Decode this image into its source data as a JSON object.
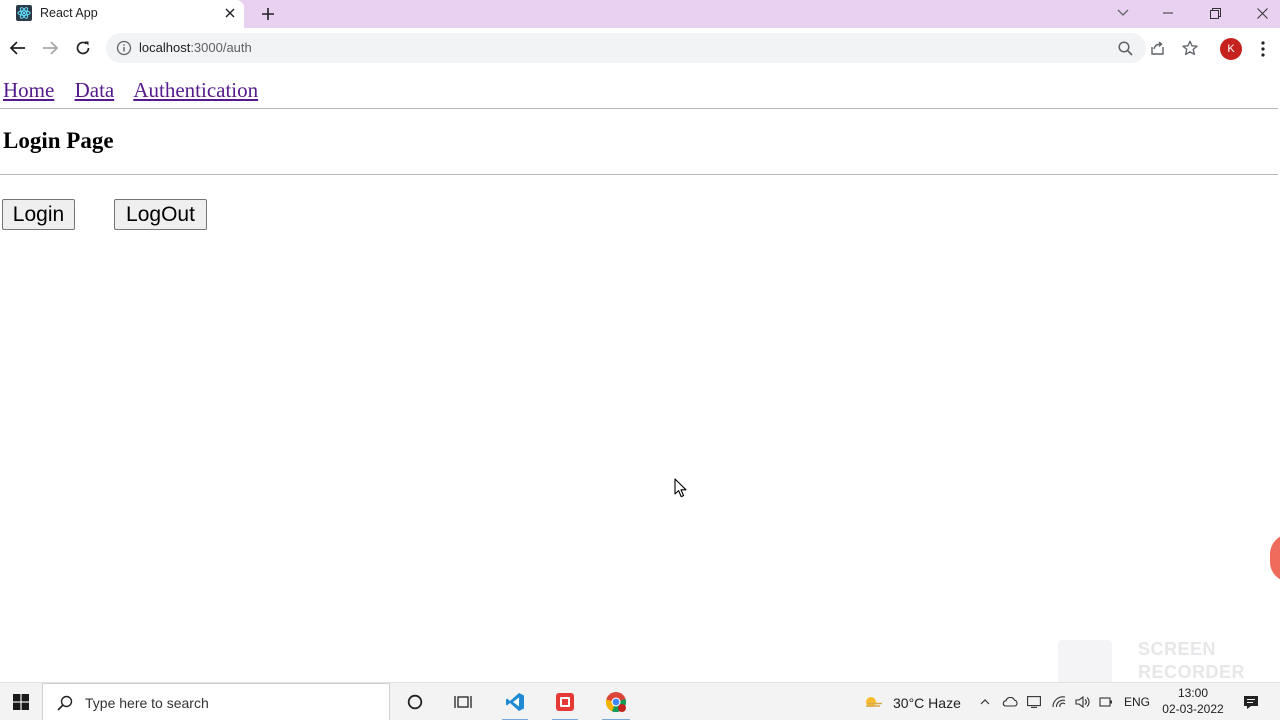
{
  "browser": {
    "tab_title": "React App",
    "url_host": "localhost",
    "url_rest": ":3000/auth",
    "profile_initial": "K"
  },
  "page": {
    "nav_links": [
      "Home",
      "Data",
      "Authentication"
    ],
    "title": "Login Page",
    "login_button": "Login",
    "logout_button": "LogOut"
  },
  "overlay": {
    "watermark_line1": "SCREEN",
    "watermark_line2": "RECORDER"
  },
  "taskbar": {
    "search_placeholder": "Type here to search",
    "weather": "30°C  Haze",
    "language": "ENG",
    "time": "13:00",
    "date": "02-03-2022"
  },
  "colors": {
    "tabstrip": "#e9d2f1",
    "link_visited": "#551a8b",
    "profile_avatar": "#c5221f"
  }
}
